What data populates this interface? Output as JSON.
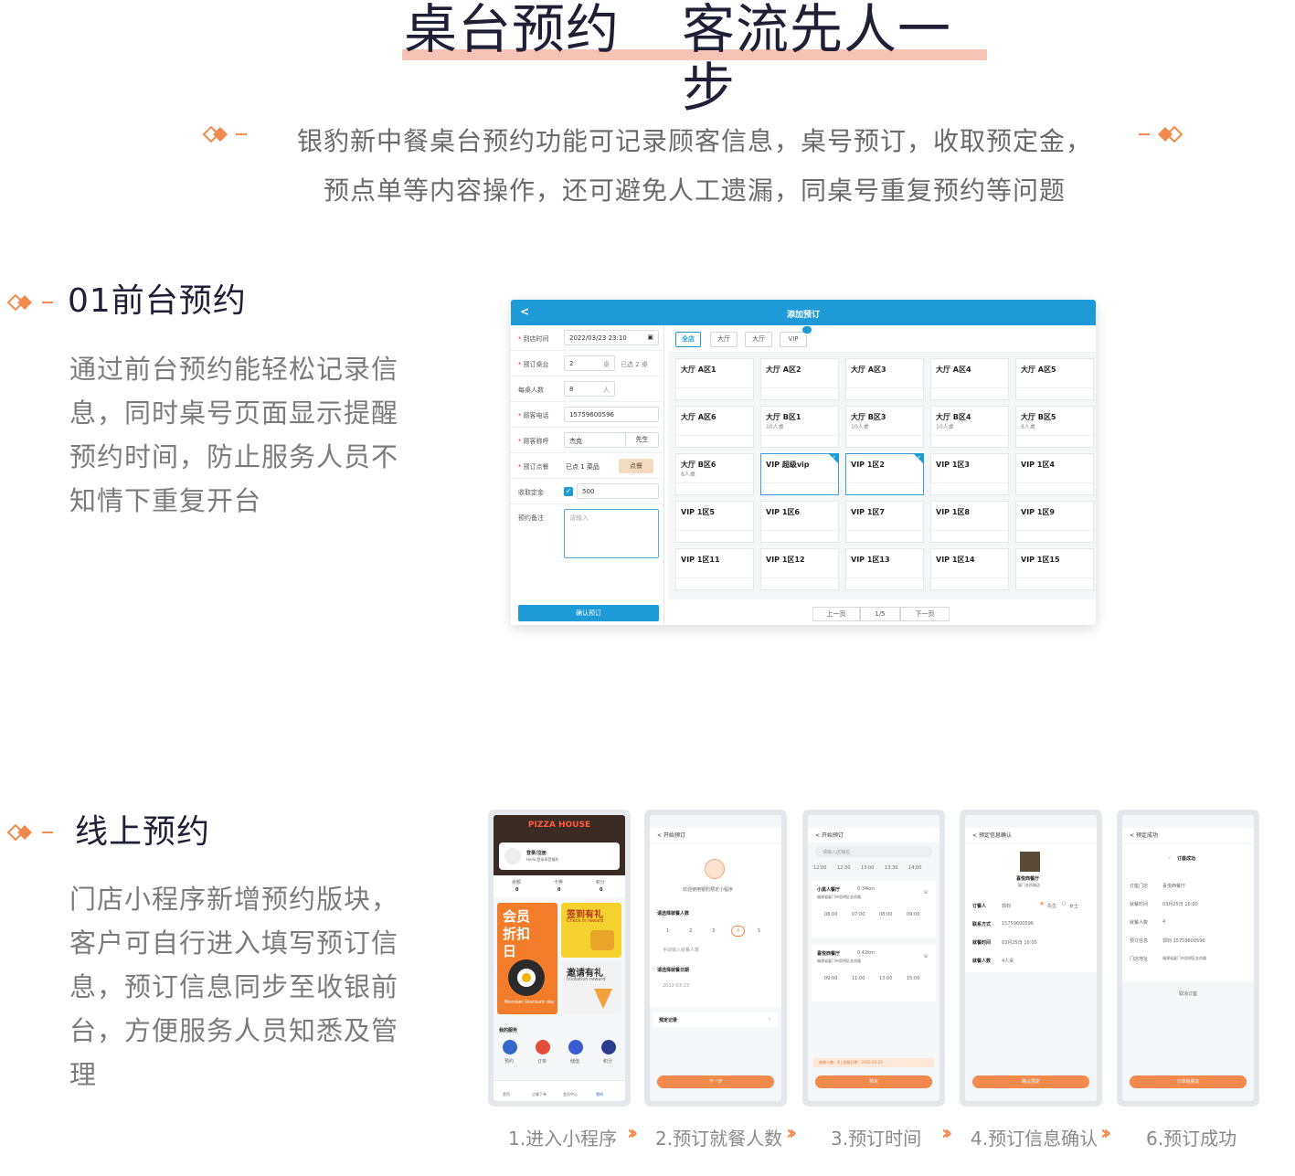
{
  "hero": {
    "title_left": "桌台预约",
    "title_right": "客流先人一步"
  },
  "intro": {
    "line1": "银豹新中餐桌台预约功能可记录顾客信息，桌号预订，收取预定金，",
    "line2": "预点单等内容操作，还可避免人工遗漏，同桌号重复预约等问题"
  },
  "section1": {
    "title": "01前台预约",
    "lines": [
      "通过前台预约能轻松记录信",
      "息，同时桌号页面显示提醒",
      "预约时间，防止服务人员不",
      "知情下重复开台"
    ]
  },
  "section2": {
    "title": "线上预约",
    "lines": [
      "门店小程序新增预约版块，",
      "客户可自行进入填写预订信",
      "息，预订信息同步至收银前",
      "台，方便服务人员知悉及管",
      "理"
    ]
  },
  "app": {
    "header": {
      "back": "<",
      "title": "添加预订"
    },
    "form": [
      {
        "label": "到店时间",
        "required": true,
        "value": "2022/03/23 23:10",
        "suffix": ""
      },
      {
        "label": "预订桌台",
        "required": true,
        "value": "2",
        "suffix": "桌",
        "extra": "已选 2 桌"
      },
      {
        "label": "每桌人数",
        "required": false,
        "value": "8",
        "suffix": "人"
      },
      {
        "label": "顾客电话",
        "required": true,
        "value": "15759600596",
        "suffix": ""
      },
      {
        "label": "顾客称呼",
        "required": true,
        "value": "杰克",
        "suffix": "先生"
      },
      {
        "label": "预订点餐",
        "required": true,
        "value": "已点 1 菜品",
        "suffix": ""
      },
      {
        "label": "收取定金",
        "required": false,
        "value": "500",
        "suffix": ""
      },
      {
        "label": "预约备注",
        "required": false,
        "value": "",
        "suffix": ""
      }
    ],
    "order_button": "点餐",
    "note_placeholder": "请输入",
    "confirm_button": "确认预订",
    "tabs": [
      {
        "label": "全店",
        "active": true
      },
      {
        "label": "大厅",
        "active": false
      },
      {
        "label": "大厅",
        "active": false
      },
      {
        "label": "VIP",
        "active": false
      }
    ],
    "tables": [
      {
        "name": "大厅 A区1",
        "people": "",
        "selected": false
      },
      {
        "name": "大厅 A区2",
        "people": "",
        "selected": false
      },
      {
        "name": "大厅 A区3",
        "people": "",
        "selected": false
      },
      {
        "name": "大厅 A区4",
        "people": "",
        "selected": false
      },
      {
        "name": "大厅 A区5",
        "people": "",
        "selected": false
      },
      {
        "name": "大厅 A区6",
        "people": "",
        "selected": false
      },
      {
        "name": "大厅 B区1",
        "people": "10人桌",
        "selected": false
      },
      {
        "name": "大厅 B区3",
        "people": "10人桌",
        "selected": false
      },
      {
        "name": "大厅 B区4",
        "people": "10人桌",
        "selected": false
      },
      {
        "name": "大厅 B区5",
        "people": "8人桌",
        "selected": false
      },
      {
        "name": "大厅 B区6",
        "people": "8人桌",
        "selected": false
      },
      {
        "name": "VIP 超级vip",
        "people": "",
        "selected": true
      },
      {
        "name": "VIP 1区2",
        "people": "",
        "selected": true
      },
      {
        "name": "VIP 1区3",
        "people": "",
        "selected": false
      },
      {
        "name": "VIP 1区4",
        "people": "",
        "selected": false
      },
      {
        "name": "VIP 1区5",
        "people": "",
        "selected": false
      },
      {
        "name": "VIP 1区6",
        "people": "",
        "selected": false
      },
      {
        "name": "VIP 1区7",
        "people": "",
        "selected": false
      },
      {
        "name": "VIP 1区8",
        "people": "",
        "selected": false
      },
      {
        "name": "VIP 1区9",
        "people": "",
        "selected": false
      },
      {
        "name": "VIP 1区11",
        "people": "",
        "selected": false
      },
      {
        "name": "VIP 1区12",
        "people": "",
        "selected": false
      },
      {
        "name": "VIP 1区13",
        "people": "",
        "selected": false
      },
      {
        "name": "VIP 1区14",
        "people": "",
        "selected": false
      },
      {
        "name": "VIP 1区15",
        "people": "",
        "selected": false
      }
    ],
    "pager": {
      "prev": "上一页",
      "page": "1/5",
      "next": "下一页"
    }
  },
  "phones": {
    "p1": {
      "brand": "PIZZA HOUSE",
      "login": "登录/注册",
      "login_sub": "Hello,登录享受福利",
      "stats": [
        {
          "k": "余额",
          "v": "0"
        },
        {
          "k": "卡券",
          "v": "0"
        },
        {
          "k": "积分",
          "v": "0"
        }
      ],
      "promo1": "会员折扣日",
      "promo1_en": "Member Discount day",
      "promo2": "签到有礼",
      "promo2_en": "Check in reward",
      "promo3": "邀请有礼",
      "promo3_en": "Invitation reward",
      "services": "我的服务",
      "service_items": [
        "预约",
        "订单",
        "储值",
        "积分"
      ],
      "tabs": [
        "首页",
        "点餐下单",
        "会员中心",
        "我的"
      ]
    },
    "p2": {
      "nav": "开始预订",
      "welcome": "欢迎使用银豹预定小程序",
      "q1": "请选择就餐人数",
      "nums": [
        "1",
        "2",
        "3",
        "4",
        "5"
      ],
      "manual": "手动输入就餐人数",
      "q2": "请选择就餐日期",
      "date": "2022-03-23",
      "record": "预定记录",
      "btn": "下一步"
    },
    "p3": {
      "nav": "开始预订",
      "search": "请输入店铺名",
      "times": [
        "12:00",
        "12:30",
        "13:00",
        "13:30",
        "14:00"
      ],
      "store1": "小黑人餐厅",
      "dist1": "0.34km",
      "addr1": "福建省厦门市思明区金尚路",
      "slots1": [
        "08:00",
        "07:00",
        "08:00",
        "09:00"
      ],
      "store2": "喜悦西餐厅",
      "dist2": "0.42km",
      "addr2": "福建省厦门市思明区金尚路",
      "slots2": [
        "09:00",
        "11:00",
        "13:00",
        "15:00"
      ],
      "footer": "就餐人数：4 | 就餐日期：2022-03-23",
      "btn": "预定"
    },
    "p4": {
      "nav": "预定信息确认",
      "store": "喜悦西餐厅",
      "store_sub": "厦门金尚路店",
      "rows": [
        {
          "k": "订餐人",
          "v": "郭钧"
        },
        {
          "k": "联系方式",
          "v": "15759600596"
        },
        {
          "k": "就餐时间",
          "v": "03月25日 10:00"
        },
        {
          "k": "就餐人数",
          "v": "4人桌"
        }
      ],
      "gender": [
        "先生",
        "女士"
      ],
      "btn": "确认预定"
    },
    "p5": {
      "nav": "预定成功",
      "success": "订座成功",
      "rows": [
        {
          "k": "订座门店",
          "v": "喜悦西餐厅"
        },
        {
          "k": "就餐时间",
          "v": "03月25日 10:00"
        },
        {
          "k": "就餐人数",
          "v": "4"
        },
        {
          "k": "预订信息",
          "v": "郭钧 15759600596"
        },
        {
          "k": "门店地址",
          "v": "福建省厦门市思明区金尚路"
        }
      ],
      "cancel": "取消订座",
      "btn": "分享给朋友"
    }
  },
  "steps": [
    "1.进入小程序",
    "2.预订就餐人数",
    "3.预订时间",
    "4.预订信息确认",
    "6.预订成功"
  ],
  "colors": {
    "accent": "#f28a4e",
    "primary": "#1e9ad6",
    "highlight": "#f6c4b4",
    "title": "#1f2036"
  }
}
